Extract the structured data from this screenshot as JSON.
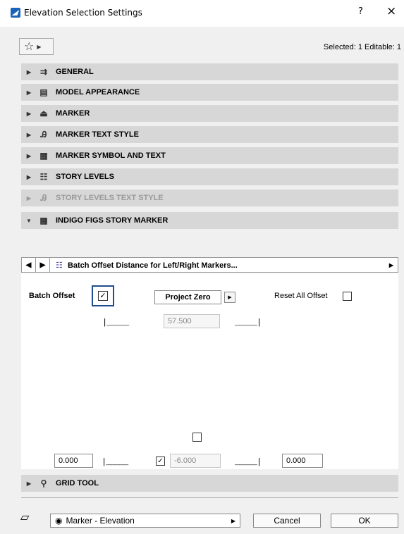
{
  "window": {
    "title": "Elevation Selection Settings",
    "help": "?",
    "close": "×"
  },
  "toolbar": {
    "selected_info": "Selected: 1 Editable: 1"
  },
  "panels": [
    {
      "label": "GENERAL",
      "icon": "general-settings-icon",
      "state": "collapsed"
    },
    {
      "label": "MODEL APPEARANCE",
      "icon": "model-appearance-icon",
      "state": "collapsed"
    },
    {
      "label": "MARKER",
      "icon": "marker-icon",
      "state": "collapsed"
    },
    {
      "label": "MARKER TEXT STYLE",
      "icon": "text-style-icon",
      "state": "collapsed"
    },
    {
      "label": "MARKER SYMBOL AND TEXT",
      "icon": "symbol-text-icon",
      "state": "collapsed"
    },
    {
      "label": "STORY LEVELS",
      "icon": "story-levels-icon",
      "state": "collapsed"
    },
    {
      "label": "STORY LEVELS TEXT STYLE",
      "icon": "text-style-icon",
      "state": "disabled"
    },
    {
      "label": "INDIGO FIGS STORY MARKER",
      "icon": "symbol-text-icon",
      "state": "expanded"
    }
  ],
  "subpanel": {
    "title": "Batch Offset Distance for Left/Right Markers..."
  },
  "content": {
    "batch_offset_label": "Batch Offset",
    "batch_offset_checked": true,
    "project_zero_label": "Project Zero",
    "reset_all_label": "Reset All Offset",
    "reset_all_checked": false,
    "top_value": "57.500",
    "bottom_checkbox_checked": false,
    "left_value": "0.000",
    "center_checked": true,
    "center_value": "-6.000",
    "right_value": "0.000"
  },
  "grid_panel": {
    "label": "GRID TOOL"
  },
  "footer": {
    "marker_select": "Marker - Elevation",
    "cancel": "Cancel",
    "ok": "OK"
  }
}
